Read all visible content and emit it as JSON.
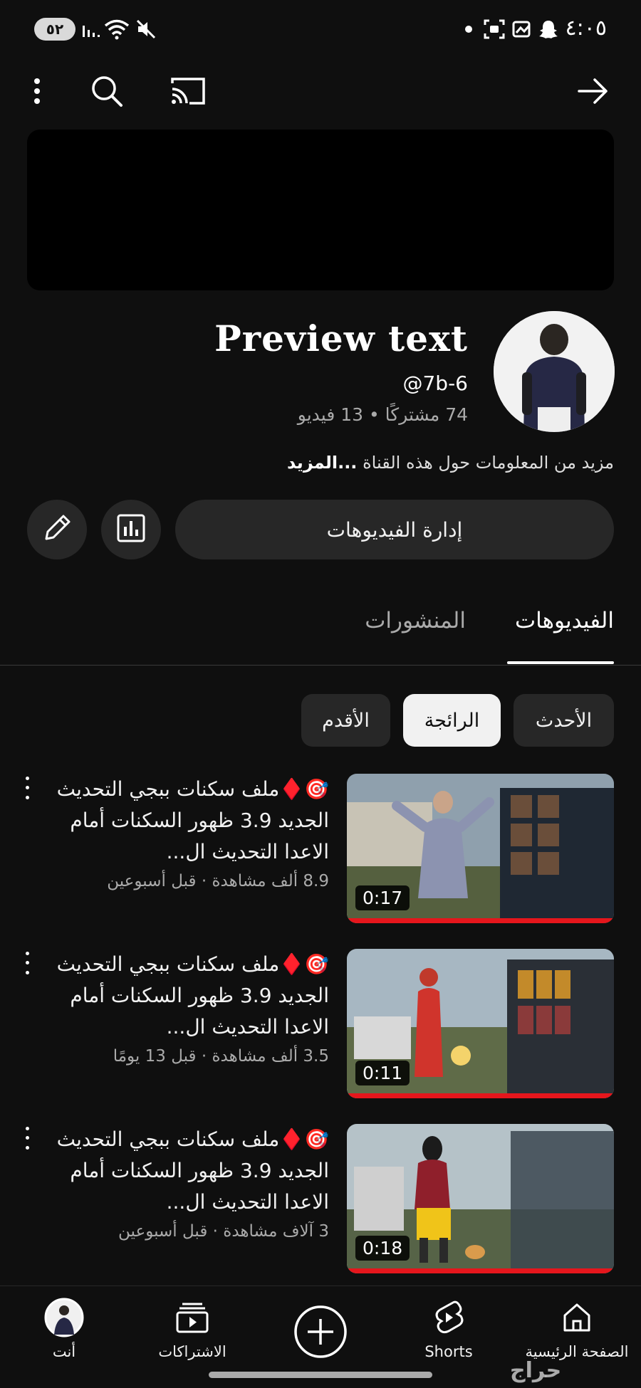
{
  "status_bar": {
    "battery": "٥٢",
    "time": "٤:٠٥",
    "left_icons": [
      "signal-icon",
      "wifi-icon",
      "mute-icon"
    ],
    "right_icons": [
      "dot-icon",
      "screenshot-icon",
      "gallery-icon",
      "snapchat-icon"
    ]
  },
  "toolbar": {
    "icons": [
      "more-vert-icon",
      "search-icon",
      "cast-icon",
      "forward-arrow-icon"
    ]
  },
  "channel": {
    "name": "Preview text",
    "handle": "@7b-6",
    "stats": "74 مشتركًا • 13 فيديو",
    "about": "مزيد من المعلومات حول هذه القناة",
    "about_more": "...المزيد"
  },
  "actions": {
    "manage_videos": "إدارة الفيديوهات",
    "icons": [
      "pencil-icon",
      "analytics-icon"
    ]
  },
  "tabs": [
    {
      "label": "الفيديوهات",
      "selected": true
    },
    {
      "label": "المنشورات",
      "selected": false
    }
  ],
  "chips": [
    {
      "label": "الأحدث",
      "selected": false
    },
    {
      "label": "الرائجة",
      "selected": true
    },
    {
      "label": "الأقدم",
      "selected": false
    }
  ],
  "videos": [
    {
      "title": "🎯♦️ملف سكنات ببجي التحديث الجديد 3.9 ظهور السكنات أمام الاعدا التحديث ال...",
      "meta": "8.9 ألف مشاهدة · قبل أسبوعين",
      "duration": "0:17"
    },
    {
      "title": "🎯♦️ملف سكنات ببجي التحديث الجديد 3.9 ظهور السكنات أمام الاعدا التحديث ال...",
      "meta": "3.5 ألف مشاهدة · قبل 13 يومًا",
      "duration": "0:11"
    },
    {
      "title": "🎯♦️ملف سكنات ببجي التحديث الجديد 3.9 ظهور السكنات أمام الاعدا التحديث ال...",
      "meta": "3 آلاف مشاهدة · قبل أسبوعين",
      "duration": "0:18"
    }
  ],
  "bottom_nav": {
    "home": "الصفحة الرئيسية",
    "shorts": "Shorts",
    "create": "",
    "subscriptions": "الاشتراكات",
    "you": "أنت"
  },
  "watermark": "حراج",
  "colors": {
    "background": "#0f0f0f",
    "surface": "#272727",
    "progress_red": "#e5161c",
    "text_primary": "#f1f1f1",
    "text_secondary": "#aaaaaa"
  }
}
